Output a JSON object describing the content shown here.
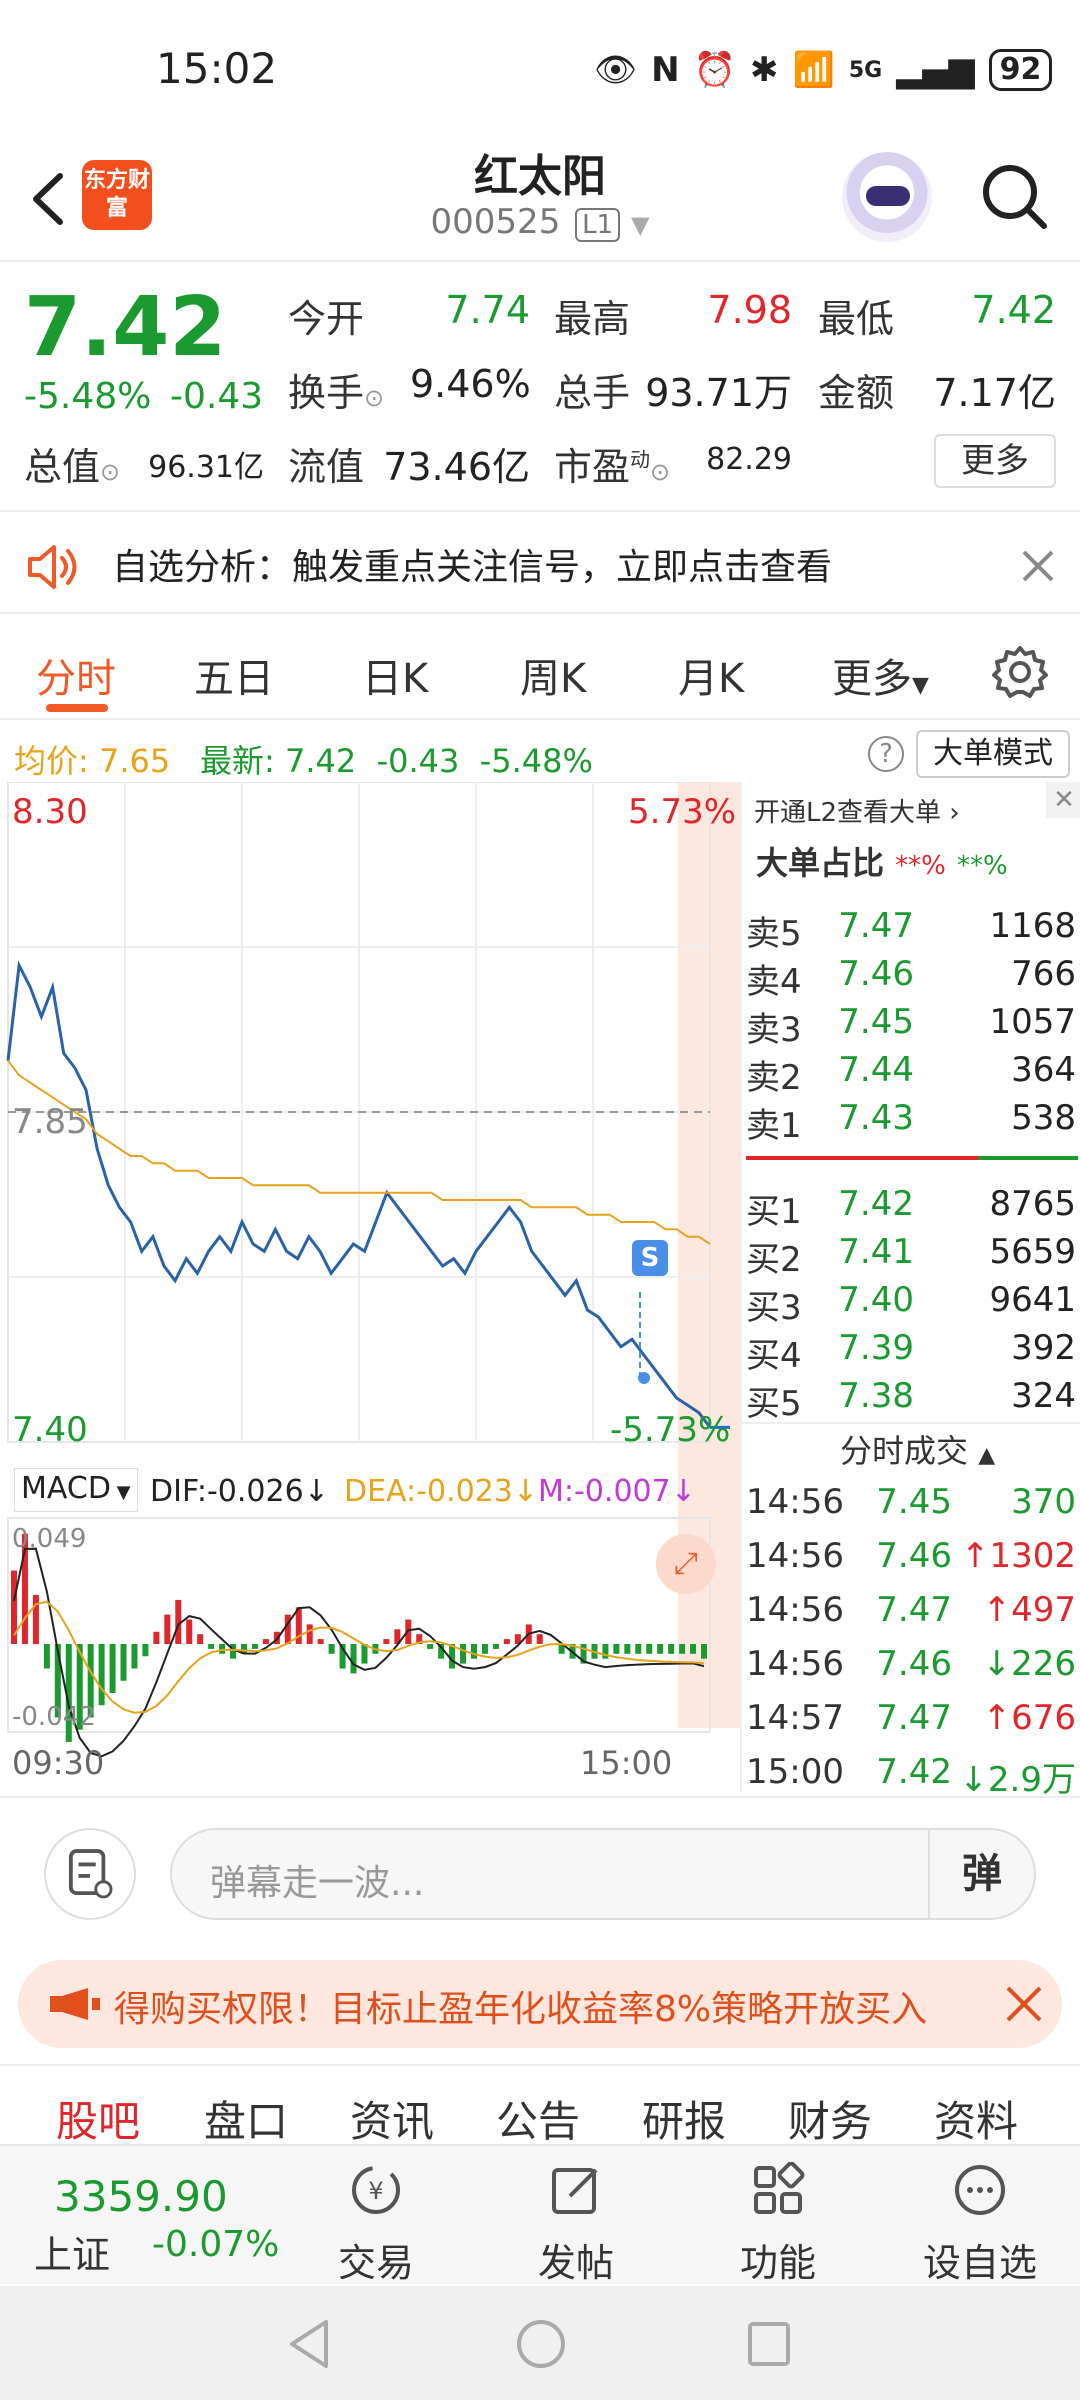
{
  "status": {
    "time": "15:02",
    "network": "5G",
    "battery": "92"
  },
  "header": {
    "name": "红太阳",
    "code": "000525",
    "level": "L1",
    "logo_text": "东方财富"
  },
  "quote": {
    "price": "7.42",
    "change_pct": "-5.48%",
    "change": "-0.43",
    "open_label": "今开",
    "open": "7.74",
    "high_label": "最高",
    "high": "7.98",
    "low_label": "最低",
    "low": "7.42",
    "turnover_label": "换手",
    "turnover": "9.46%",
    "volume_label": "总手",
    "volume": "93.71万",
    "amount_label": "金额",
    "amount": "7.17亿",
    "mktcap_label": "总值",
    "mktcap": "96.31亿",
    "float_label": "流值",
    "float": "73.46亿",
    "pe_label": "市盈",
    "pe_sup": "动",
    "pe": "82.29",
    "more_label": "更多"
  },
  "alert": {
    "text": "自选分析：触发重点关注信号，立即点击查看"
  },
  "tabs": [
    "分时",
    "五日",
    "日K",
    "周K",
    "月K",
    "更多"
  ],
  "avg": {
    "avg_label": "均价:",
    "avg_value": "7.65",
    "latest_label": "最新:",
    "latest_price": "7.42",
    "latest_change": "-0.43",
    "latest_pct": "-5.48%",
    "bigorder_btn": "大单模式"
  },
  "chart_labels": {
    "top_price": "8.30",
    "top_pct": "5.73%",
    "mid_price": "7.85",
    "bottom_price": "7.40",
    "bottom_pct": "-5.73%",
    "macd": "MACD",
    "dif": "DIF:-0.026↓",
    "dea": "DEA:-0.023↓",
    "m": "M:-0.007↓",
    "macd_top": "0.049",
    "macd_bottom": "-0.042",
    "time_start": "09:30",
    "time_end": "15:00",
    "marker": "S"
  },
  "chart_data": {
    "type": "line",
    "ylim": [
      7.4,
      8.3
    ],
    "series": [
      {
        "values": [
          7.92,
          8.05,
          8.02,
          7.98,
          8.02,
          7.93,
          7.91,
          7.88,
          7.8,
          7.75,
          7.72,
          7.7,
          7.66,
          7.68,
          7.64,
          7.62,
          7.65,
          7.63,
          7.66,
          7.68,
          7.66,
          7.7,
          7.67,
          7.66,
          7.69,
          7.66,
          7.65,
          7.68,
          7.66,
          7.63,
          7.65,
          7.67,
          7.66,
          7.7,
          7.74,
          7.72,
          7.7,
          7.68,
          7.66,
          7.64,
          7.65,
          7.63,
          7.66,
          7.68,
          7.7,
          7.72,
          7.7,
          7.66,
          7.64,
          7.62,
          7.6,
          7.62,
          7.58,
          7.57,
          7.55,
          7.53,
          7.54,
          7.52,
          7.5,
          7.48,
          7.46,
          7.45,
          7.44,
          7.42
        ]
      },
      {
        "values": [
          7.92,
          7.9,
          7.89,
          7.88,
          7.87,
          7.86,
          7.85,
          7.84,
          7.82,
          7.81,
          7.8,
          7.79,
          7.79,
          7.78,
          7.78,
          7.77,
          7.77,
          7.77,
          7.76,
          7.76,
          7.76,
          7.76,
          7.75,
          7.75,
          7.75,
          7.75,
          7.75,
          7.75,
          7.74,
          7.74,
          7.74,
          7.74,
          7.74,
          7.74,
          7.74,
          7.74,
          7.74,
          7.74,
          7.74,
          7.73,
          7.73,
          7.73,
          7.73,
          7.73,
          7.73,
          7.73,
          7.73,
          7.72,
          7.72,
          7.72,
          7.72,
          7.72,
          7.71,
          7.71,
          7.71,
          7.7,
          7.7,
          7.7,
          7.7,
          7.69,
          7.69,
          7.68,
          7.68,
          7.67
        ]
      }
    ],
    "macd_hist": [
      0.03,
      0.045,
      0.02,
      -0.01,
      -0.03,
      -0.04,
      -0.035,
      -0.03,
      -0.025,
      -0.02,
      -0.015,
      -0.01,
      -0.005,
      0.005,
      0.012,
      0.018,
      0.01,
      0.004,
      -0.002,
      -0.004,
      -0.006,
      -0.004,
      -0.002,
      0.002,
      0.005,
      0.012,
      0.015,
      0.008,
      0.002,
      -0.004,
      -0.01,
      -0.012,
      -0.008,
      -0.004,
      0.002,
      0.006,
      0.01,
      0.004,
      -0.002,
      -0.006,
      -0.01,
      -0.008,
      -0.006,
      -0.004,
      -0.002,
      0.002,
      0.004,
      0.008,
      0.004,
      0.0,
      -0.004,
      -0.006,
      -0.008,
      -0.006,
      -0.006,
      -0.004,
      -0.004,
      -0.004,
      -0.004,
      -0.004,
      -0.004,
      -0.004,
      -0.004,
      -0.006
    ]
  },
  "level2": {
    "open_l2": "开通L2查看大单",
    "big_ratio_label": "大单占比",
    "big_ratio_red": "**%",
    "big_ratio_green": "**%",
    "asks": [
      {
        "label": "卖5",
        "price": "7.47",
        "vol": "1168"
      },
      {
        "label": "卖4",
        "price": "7.46",
        "vol": "766"
      },
      {
        "label": "卖3",
        "price": "7.45",
        "vol": "1057"
      },
      {
        "label": "卖2",
        "price": "7.44",
        "vol": "364"
      },
      {
        "label": "卖1",
        "price": "7.43",
        "vol": "538"
      }
    ],
    "bids": [
      {
        "label": "买1",
        "price": "7.42",
        "vol": "8765"
      },
      {
        "label": "买2",
        "price": "7.41",
        "vol": "5659"
      },
      {
        "label": "买3",
        "price": "7.40",
        "vol": "9641"
      },
      {
        "label": "买4",
        "price": "7.39",
        "vol": "392"
      },
      {
        "label": "买5",
        "price": "7.38",
        "vol": "324"
      }
    ],
    "trades_title": "分时成交",
    "trades": [
      {
        "time": "14:56",
        "price": "7.45",
        "vol": "370",
        "arrow": ""
      },
      {
        "time": "14:56",
        "price": "7.46",
        "vol": "1302",
        "arrow": "↑"
      },
      {
        "time": "14:56",
        "price": "7.47",
        "vol": "497",
        "arrow": "↑"
      },
      {
        "time": "14:56",
        "price": "7.46",
        "vol": "226",
        "arrow": "↓"
      },
      {
        "time": "14:57",
        "price": "7.47",
        "vol": "676",
        "arrow": "↑"
      },
      {
        "time": "15:00",
        "price": "7.42",
        "vol": "2.9万",
        "arrow": "↓"
      }
    ]
  },
  "danmu": {
    "placeholder": "弹幕走一波...",
    "send_label": "弹"
  },
  "promo": {
    "text": "得购买权限！目标止盈年化收益率8%策略开放买入"
  },
  "section_tabs": [
    "股吧",
    "盘口",
    "资讯",
    "公告",
    "研报",
    "财务",
    "资料"
  ],
  "bottom": {
    "index_value": "3359.90",
    "index_name": "上证",
    "index_change": "-0.07%",
    "nav": [
      "交易",
      "发帖",
      "功能",
      "设自选"
    ]
  },
  "colors": {
    "up": "#e0262b",
    "down": "#1a9a2f",
    "avg": "#e8a31c",
    "accent": "#f05a28",
    "price_line": "#2a62a8"
  }
}
